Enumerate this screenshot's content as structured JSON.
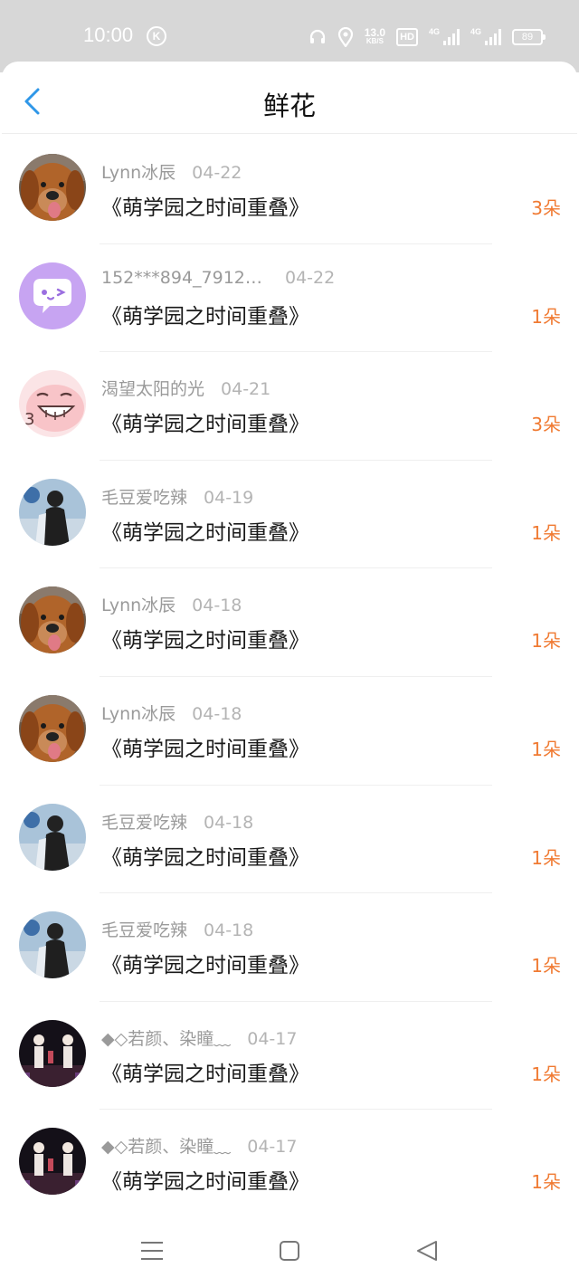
{
  "status_bar": {
    "time": "10:00",
    "k_badge": "K",
    "net_speed": "13.0",
    "net_unit": "KB/S",
    "hd": "HD",
    "net1": "4G",
    "net2": "4G",
    "battery": "89",
    "icons": [
      "headset-icon",
      "location-icon",
      "signal-icon",
      "battery-icon"
    ]
  },
  "header": {
    "title": "鲜花",
    "back_icon": "chevron-left-icon"
  },
  "accent_color": "#f07a32",
  "back_color": "#2f97e8",
  "rows": [
    {
      "name": "Lynn冰辰",
      "date": "04-22",
      "book": "《萌学园之时间重叠》",
      "count": "3朵",
      "avatar": "dog"
    },
    {
      "name": "152***894_79120...",
      "date": "04-22",
      "book": "《萌学园之时间重叠》",
      "count": "1朵",
      "avatar": "chat-bubble"
    },
    {
      "name": "渴望太阳的光",
      "date": "04-21",
      "book": "《萌学园之时间重叠》",
      "count": "3朵",
      "avatar": "pink-face"
    },
    {
      "name": "毛豆爱吃辣",
      "date": "04-19",
      "book": "《萌学园之时间重叠》",
      "count": "1朵",
      "avatar": "person"
    },
    {
      "name": "Lynn冰辰",
      "date": "04-18",
      "book": "《萌学园之时间重叠》",
      "count": "1朵",
      "avatar": "dog"
    },
    {
      "name": "Lynn冰辰",
      "date": "04-18",
      "book": "《萌学园之时间重叠》",
      "count": "1朵",
      "avatar": "dog"
    },
    {
      "name": "毛豆爱吃辣",
      "date": "04-18",
      "book": "《萌学园之时间重叠》",
      "count": "1朵",
      "avatar": "person"
    },
    {
      "name": "毛豆爱吃辣",
      "date": "04-18",
      "book": "《萌学园之时间重叠》",
      "count": "1朵",
      "avatar": "person"
    },
    {
      "name": "◆◇若颜、染瞳﹏",
      "date": "04-17",
      "book": "《萌学园之时间重叠》",
      "count": "1朵",
      "avatar": "stage"
    },
    {
      "name": "◆◇若颜、染瞳﹏",
      "date": "04-17",
      "book": "《萌学园之时间重叠》",
      "count": "1朵",
      "avatar": "stage"
    }
  ],
  "nav_bar": {
    "icons": [
      "menu-icon",
      "home-square-icon",
      "back-triangle-icon"
    ]
  }
}
